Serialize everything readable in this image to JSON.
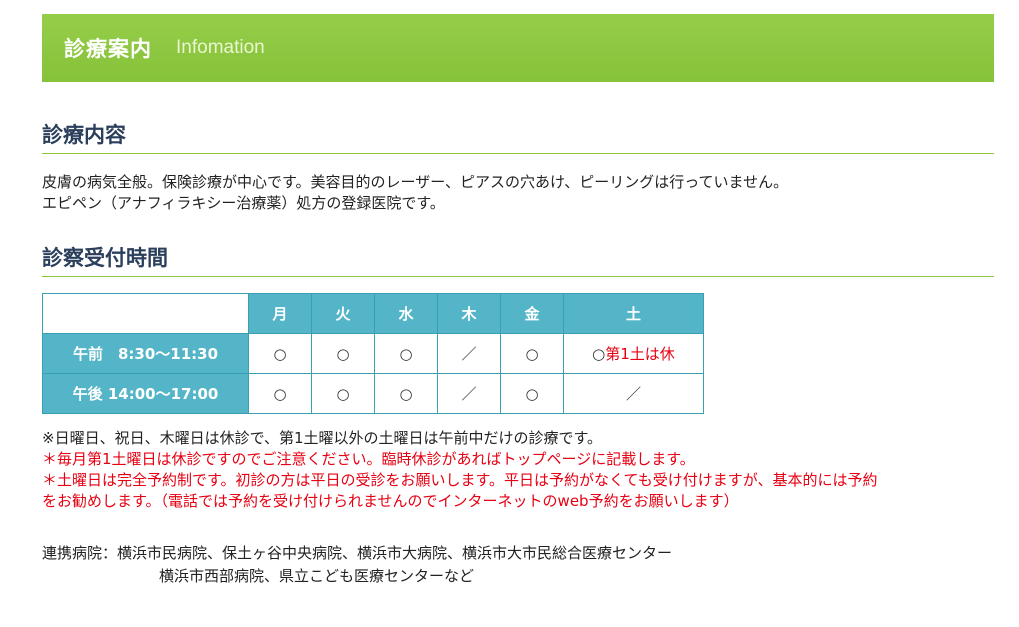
{
  "banner": {
    "title": "診療案内",
    "subtitle": "Infomation"
  },
  "services": {
    "heading": "診療内容",
    "lines": [
      "皮膚の病気全般。保険診療が中心です。美容目的のレーザー、ピアスの穴あけ、ピーリングは行っていません。",
      "エピペン（アナフィラキシー治療薬）処方の登録医院です。"
    ]
  },
  "hours": {
    "heading": "診察受付時間",
    "days": [
      "月",
      "火",
      "水",
      "木",
      "金",
      "土"
    ],
    "rows": [
      {
        "label": "午前　8:30〜11:30",
        "cells": [
          "○",
          "○",
          "○",
          "／",
          "○"
        ],
        "sat_mark": "○",
        "sat_note": "第1土は休"
      },
      {
        "label": "午後 14:00〜17:00",
        "cells": [
          "○",
          "○",
          "○",
          "／",
          "○"
        ],
        "sat_mark": "／",
        "sat_note": ""
      }
    ]
  },
  "notes": [
    "※日曜日、祝日、木曜日は休診で、第1土曜以外の土曜日は午前中だけの診療です。",
    "＊毎月第1土曜日は休診ですのでご注意ください。臨時休診があればトップページに記載します。",
    "＊土曜日は完全予約制です。初診の方は平日の受診をお願いします。平日は予約がなくても受け付けますが、基本的には予約",
    "をお勧めします。（電話では予約を受け付けられませんのでインターネットのweb予約をお願いします）"
  ],
  "partners": {
    "line1": "連携病院：横浜市民病院、保土ヶ谷中央病院、横浜市大病院、横浜市大市民総合医療センター",
    "line2": "横浜市西部病院、県立こども医療センターなど"
  },
  "colors": {
    "banner": "#8cc63f",
    "heading": "#2b3f5c",
    "table_head": "#55b5c8",
    "alert": "#e60012"
  }
}
